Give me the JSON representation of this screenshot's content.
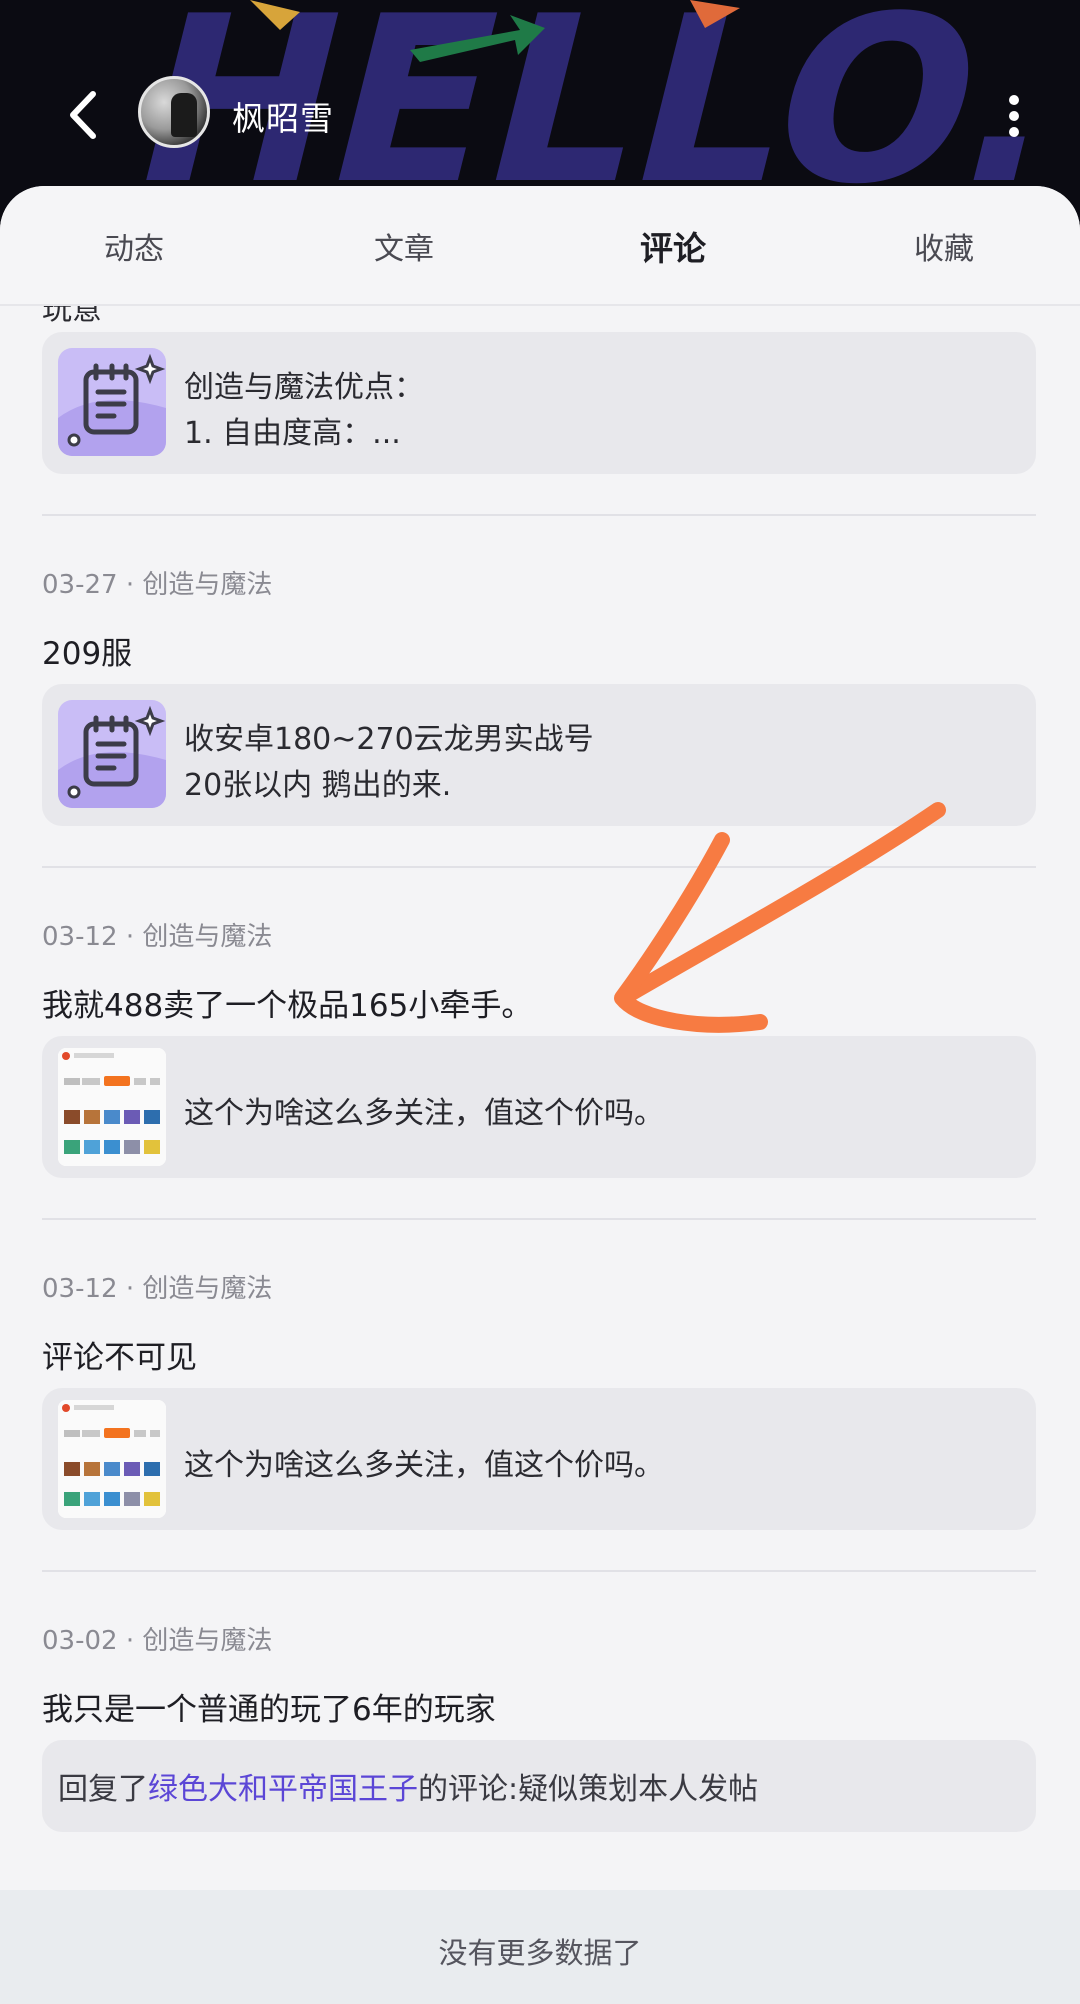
{
  "header": {
    "username": "枫昭雪",
    "banner_text": "HELLO."
  },
  "tabs": [
    {
      "label": "动态"
    },
    {
      "label": "文章"
    },
    {
      "label": "评论",
      "active": true
    },
    {
      "label": "收藏"
    }
  ],
  "feed": {
    "cut_text": "玩意",
    "items": [
      {
        "quote_lines": [
          "创造与魔法优点：",
          "1. 自由度高：..."
        ]
      },
      {
        "meta": "03-27 · 创造与魔法",
        "text": "209服",
        "quote_lines": [
          "收安卓180~270云龙男实战号",
          "20张以内 鹅出的来."
        ]
      },
      {
        "meta": "03-12 · 创造与魔法",
        "text": "我就488卖了一个极品165小牵手。",
        "quote_lines": [
          "这个为啥这么多关注，值这个价吗。"
        ]
      },
      {
        "meta": "03-12 · 创造与魔法",
        "text": "评论不可见",
        "quote_lines": [
          "这个为啥这么多关注，值这个价吗。"
        ]
      },
      {
        "meta": "03-02 · 创造与魔法",
        "text": "我只是一个普通的玩了6年的玩家",
        "reply_prefix": "回复了",
        "reply_user": "绿色大和平帝国王子",
        "reply_suffix": "的评论:疑似策划本人发帖"
      }
    ]
  },
  "footer": {
    "text": "没有更多数据了"
  },
  "colors": {
    "accent": "#b8a6ff",
    "link": "#5b46d6",
    "arrow": "#f77b42"
  }
}
